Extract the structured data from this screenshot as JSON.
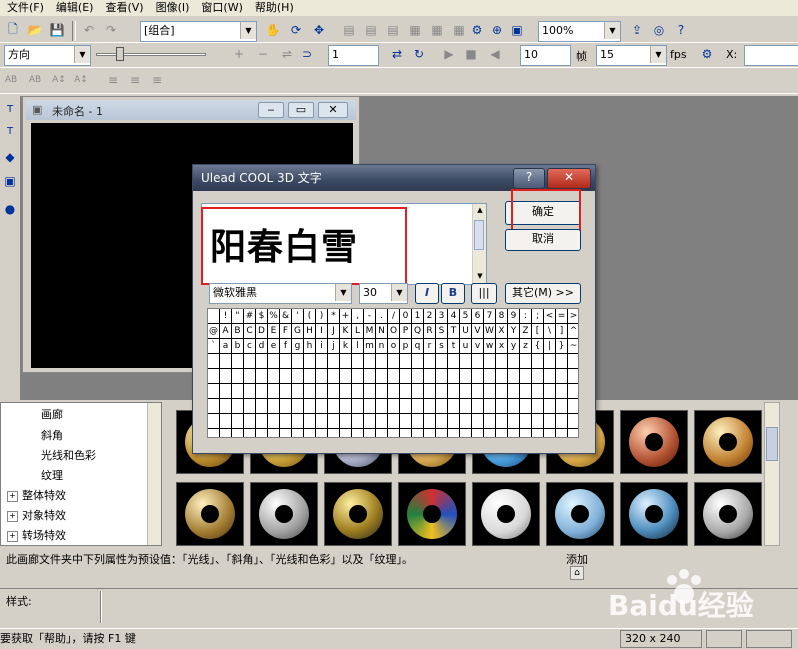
{
  "menu": [
    "文件(F)",
    "编辑(E)",
    "查看(V)",
    "图像(I)",
    "窗口(W)",
    "帮助(H)"
  ],
  "toolbar1": {
    "object_select": "[组合]",
    "zoom": "100%"
  },
  "toolbar2": {
    "direction": "方向",
    "frame_input": "1",
    "fps_value": "10",
    "frame_label": "帧",
    "frames_total": "15",
    "fps_label": "fps",
    "x_label": "X:"
  },
  "document": {
    "title": "未命名 - 1"
  },
  "dialog": {
    "title": "Ulead COOL 3D 文字",
    "text_value": "阳春白雪",
    "ok": "确定",
    "cancel": "取消",
    "font": "微软雅黑",
    "size": "30",
    "italic": "I",
    "bold": "B",
    "others": "其它(M) >>",
    "grid_rows": [
      [
        "",
        "!",
        "\"",
        "#",
        "$",
        "%",
        "&",
        "'",
        "(",
        ")",
        "*",
        "+",
        ",",
        "-",
        ".",
        "/",
        "0",
        "1",
        "2",
        "3",
        "4",
        "5",
        "6",
        "7",
        "8",
        "9",
        ":",
        ";",
        "<",
        "=",
        ">",
        "?"
      ],
      [
        "@",
        "A",
        "B",
        "C",
        "D",
        "E",
        "F",
        "G",
        "H",
        "I",
        "J",
        "K",
        "L",
        "M",
        "N",
        "O",
        "P",
        "Q",
        "R",
        "S",
        "T",
        "U",
        "V",
        "W",
        "X",
        "Y",
        "Z",
        "[",
        "\\",
        "]",
        "^",
        "_"
      ],
      [
        "`",
        "a",
        "b",
        "c",
        "d",
        "e",
        "f",
        "g",
        "h",
        "i",
        "j",
        "k",
        "l",
        "m",
        "n",
        "o",
        "p",
        "q",
        "r",
        "s",
        "t",
        "u",
        "v",
        "w",
        "x",
        "y",
        "z",
        "{",
        "|",
        "}",
        "~",
        ""
      ]
    ]
  },
  "tree": {
    "children": [
      "画廊",
      "斜角",
      "光线和色彩",
      "纹理"
    ],
    "groups": [
      "整体特效",
      "对象特效",
      "转场特效"
    ]
  },
  "description": "此画廊文件夹中下列属性为预设值：「光线」、「斜角」、「光线和色彩」以及「纹理」。",
  "add_label": "添加",
  "style_label": "样式:",
  "status": {
    "help": "要获取「帮助」，请按 F1 键",
    "size": "320 x 240"
  },
  "watermark": "Baidu经验",
  "colors": {
    "highlight": "#e02020",
    "title_bar": "#3b4a63"
  }
}
